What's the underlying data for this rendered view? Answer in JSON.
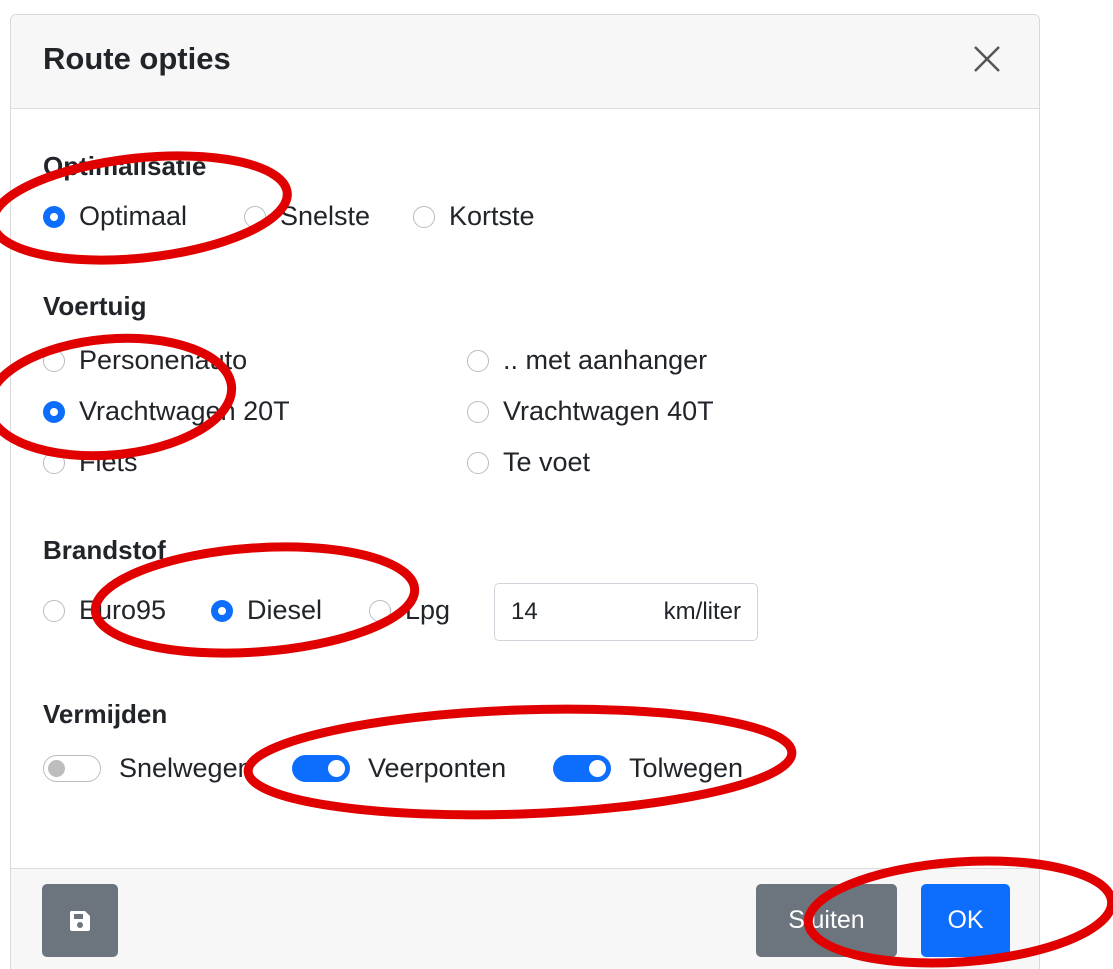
{
  "dialog": {
    "title": "Route opties",
    "close_icon": "close-icon"
  },
  "optimalisatie": {
    "label": "Optimalisatie",
    "options": [
      {
        "label": "Optimaal",
        "checked": true
      },
      {
        "label": "Snelste",
        "checked": false
      },
      {
        "label": "Kortste",
        "checked": false
      }
    ]
  },
  "voertuig": {
    "label": "Voertuig",
    "options": [
      {
        "label": "Personenauto",
        "checked": false
      },
      {
        "label": ".. met aanhanger",
        "checked": false
      },
      {
        "label": "Vrachtwagen 20T",
        "checked": true
      },
      {
        "label": "Vrachtwagen 40T",
        "checked": false
      },
      {
        "label": "Fiets",
        "checked": false
      },
      {
        "label": "Te voet",
        "checked": false
      }
    ]
  },
  "brandstof": {
    "label": "Brandstof",
    "options": [
      {
        "label": "Euro95",
        "checked": false
      },
      {
        "label": "Diesel",
        "checked": true
      },
      {
        "label": "Lpg",
        "checked": false
      }
    ],
    "consumption_value": "14",
    "consumption_unit": "km/liter"
  },
  "vermijden": {
    "label": "Vermijden",
    "toggles": [
      {
        "label": "Snelwegen",
        "on": false
      },
      {
        "label": "Veerponten",
        "on": true
      },
      {
        "label": "Tolwegen",
        "on": true
      }
    ]
  },
  "footer": {
    "save_icon": "floppy-disk-icon",
    "close_label": "Sluiten",
    "ok_label": "OK"
  },
  "colors": {
    "accent": "#0d6efd",
    "secondary": "#6c757d",
    "annotation": "#e00000"
  }
}
